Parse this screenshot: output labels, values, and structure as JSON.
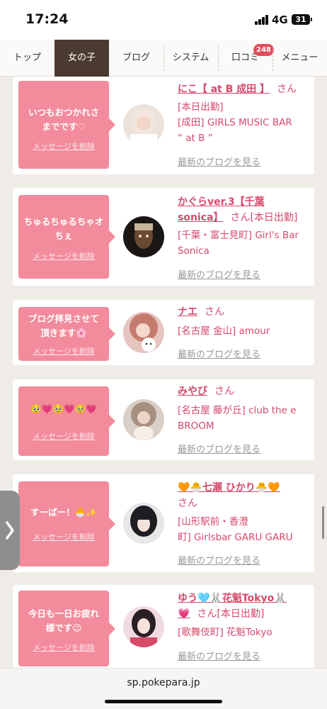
{
  "status": {
    "time": "17:24",
    "network": "4G",
    "battery": "31"
  },
  "nav": {
    "tabs": [
      "トップ",
      "女の子",
      "ブログ",
      "システム",
      "口コミ",
      "メニュー"
    ],
    "active": "女の子",
    "badge": "248"
  },
  "cards": [
    {
      "message_lines": [
        "いつもおつかれさ",
        "までです♡"
      ],
      "delete_label": "メッセージを削除",
      "name": "にこ【 at B 成田 】",
      "san": "さん",
      "shop_lines": [
        "[本日出勤]",
        "[成田] GIRLS MUSIC BAR",
        "“ at B ”"
      ],
      "blog_label": "最新のブログを見る"
    },
    {
      "message_lines": [
        "ちゅるちゅるちゃオ",
        "ちぇ"
      ],
      "delete_label": "メッセージを削除",
      "name_lines": [
        "かぐらver.3【千葉",
        "sonica】"
      ],
      "san_inline": "さん[本日出勤]",
      "shop_lines": [
        "[千葉・富士見町] Girl's Bar",
        "Sonica"
      ],
      "blog_label": "最新のブログを見る"
    },
    {
      "message_lines": [
        "ブログ拝見させて",
        "頂きます🌸"
      ],
      "delete_label": "メッセージを削除",
      "name": "ナエ",
      "san": "さん",
      "shop_lines": [
        "[名古屋 金山] amour"
      ],
      "blog_label": "最新のブログを見る"
    },
    {
      "message_lines": [
        "🥹💗🥹💗🥹💗"
      ],
      "delete_label": "メッセージを削除",
      "name": "みやび",
      "san": "さん",
      "shop_lines": [
        "[名古屋 藤が丘] club the e",
        "BROOM"
      ],
      "blog_label": "最新のブログを見る"
    },
    {
      "message_lines": [
        "すーぱー！🐣✨"
      ],
      "delete_label": "メッセージを削除",
      "name": "🧡🐣七瀬 ひかり🐣🧡",
      "san": "さん",
      "shop_lines": [
        "[山形駅前・香澄",
        "町] Girlsbar GARU GARU"
      ],
      "blog_label": "最新のブログを見る"
    },
    {
      "message_lines": [
        "今日も一日お疲れ",
        "様です😉"
      ],
      "delete_label": "メッセージを削除",
      "name_lines": [
        "ゆう🩵🐰花魁Tokyo🐰",
        "💗"
      ],
      "san_inline": "さん[本日出勤]",
      "shop_lines": [
        "[歌舞伎町] 花魁Tokyo"
      ],
      "blog_label": "最新のブログを見る"
    }
  ],
  "url": "sp.pokepara.jp",
  "colors": {
    "accent": "#d7486a",
    "bubble": "#f28b9b",
    "nav_active": "#4b3a30",
    "badge": "#e44b5a"
  }
}
